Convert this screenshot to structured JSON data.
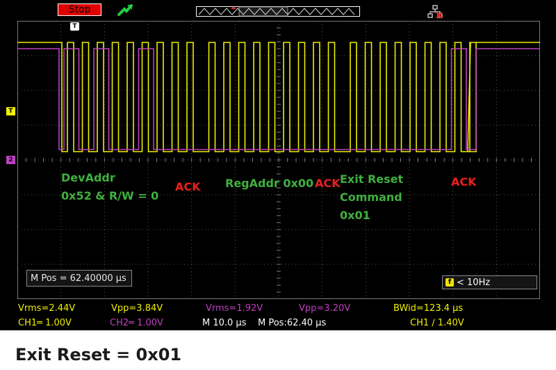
{
  "toolbar": {
    "run_state_label": "Stop"
  },
  "markers": {
    "trigger_top": "T",
    "ch1": "T",
    "ch2": "2"
  },
  "annotations": {
    "dev_addr": "DevAddr\n0x52 & R/W = 0",
    "ack1": "ACK",
    "reg_addr": "RegAddr 0x00",
    "ack2": "ACK",
    "command": "Exit Reset\nCommand\n0x01",
    "ack3": "ACK"
  },
  "overlays": {
    "mpos_box": "M Pos = 62.40000 µs",
    "trigger_freq": "< 10Hz",
    "trigger_freq_icon": "f"
  },
  "status": {
    "ch1_vrms": "Vrms=2.44V",
    "ch1_vpp": "Vpp=3.84V",
    "ch2_vrms": "Vrms=1.92V",
    "ch2_vpp": "Vpp=3.20V",
    "bandwidth": "BWid=123.4 µs",
    "ch1_scale": "CH1═ 1.00V",
    "ch2_scale": "CH2═ 1.00V",
    "timebase": "M 10.0 µs",
    "mpos": "M Pos:62.40 µs",
    "trigger": "CH1 ∕ 1.40V"
  },
  "caption": "Exit Reset = 0x01",
  "colors": {
    "ch1": "#f0f000",
    "ch2": "#c040c0",
    "annotation_green": "#40b040",
    "annotation_red": "#e82020",
    "stop_button": "#e00000"
  },
  "icons": {
    "trigger_status": "trigger-arrow-icon",
    "network": "network-disconnected-icon"
  }
}
